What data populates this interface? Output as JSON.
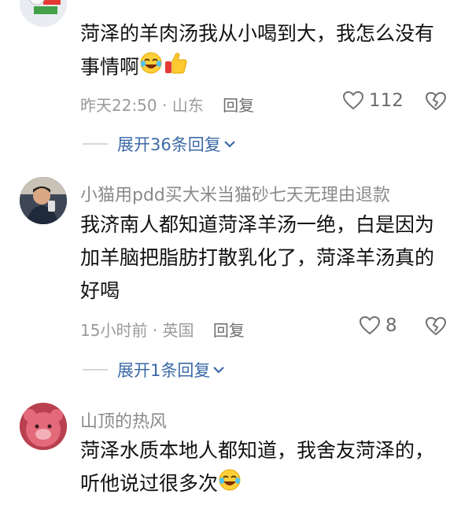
{
  "comments": [
    {
      "username": "",
      "text": "菏泽的羊肉汤我从小喝到大，我怎么没有事情啊",
      "emojis": [
        "laugh-cry-emoji",
        "thumbs-up-emoji"
      ],
      "time_location": "昨天22:50 · 山东",
      "reply_label": "回复",
      "like_count": "112",
      "expand_label": "展开36条回复"
    },
    {
      "username": "小猫用pdd买大米当猫砂七天无理由退款",
      "text": "我济南人都知道菏泽羊汤一绝，白是因为加羊脑把脂肪打散乳化了，菏泽羊汤真的好喝",
      "emojis": [],
      "time_location": "15小时前 · 英国",
      "reply_label": "回复",
      "like_count": "8",
      "expand_label": "展开1条回复"
    },
    {
      "username": "山顶的热风",
      "text": "菏泽水质本地人都知道，我舍友菏泽的，听他说过很多次",
      "emojis": [
        "laugh-cry-emoji"
      ]
    }
  ],
  "icons": {
    "like": "heart-outline-icon",
    "dislike": "broken-heart-outline-icon",
    "expand": "chevron-down-icon"
  },
  "colors": {
    "link": "#3c6aa6",
    "meta": "#9a9a9a"
  }
}
